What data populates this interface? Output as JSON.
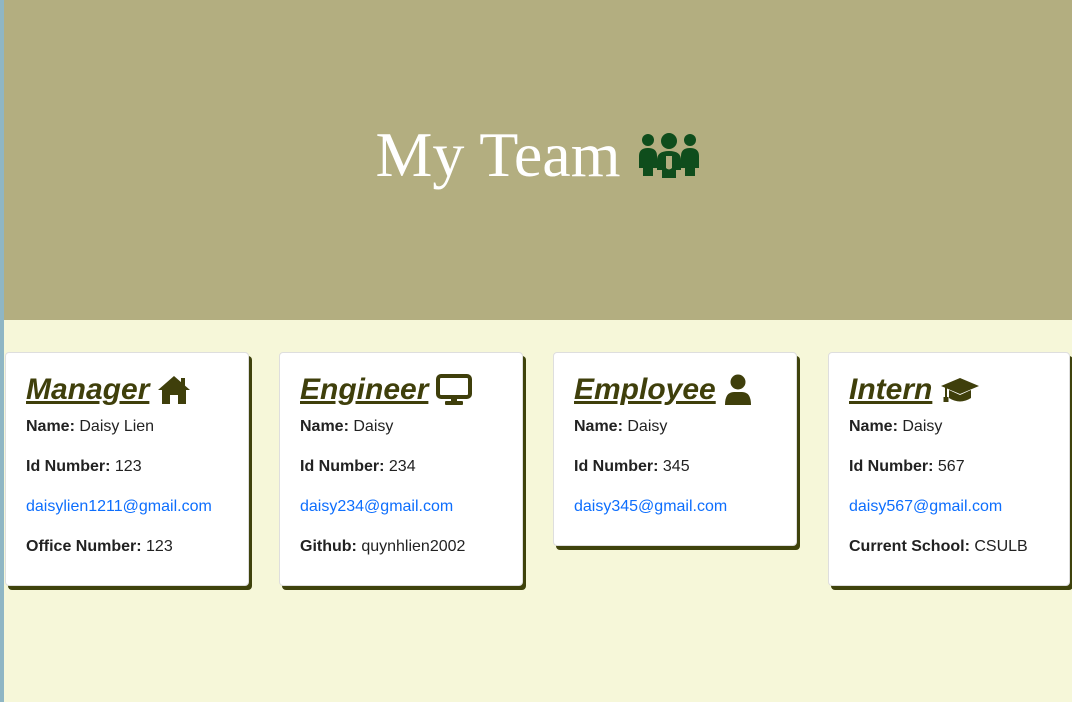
{
  "header": {
    "title": "My Team",
    "icon": "people-group-icon",
    "icon_color": "#0f4d1c",
    "background": "#b3ae80"
  },
  "cards": [
    {
      "role": "Manager",
      "icon": "house-icon",
      "name_label": "Name:",
      "name": "Daisy Lien",
      "id_label": "Id Number:",
      "id": "123",
      "email": "daisylien1211@gmail.com",
      "extra_label": "Office Number:",
      "extra_value": "123"
    },
    {
      "role": "Engineer",
      "icon": "desktop-icon",
      "name_label": "Name:",
      "name": "Daisy",
      "id_label": "Id Number:",
      "id": "234",
      "email": "daisy234@gmail.com",
      "extra_label": "Github:",
      "extra_value": "quynhlien2002"
    },
    {
      "role": "Employee",
      "icon": "user-icon",
      "name_label": "Name:",
      "name": "Daisy",
      "id_label": "Id Number:",
      "id": "345",
      "email": "daisy345@gmail.com"
    },
    {
      "role": "Intern",
      "icon": "graduation-cap-icon",
      "name_label": "Name:",
      "name": "Daisy",
      "id_label": "Id Number:",
      "id": "567",
      "email": "daisy567@gmail.com",
      "extra_label": "Current School:",
      "extra_value": "CSULB"
    }
  ],
  "colors": {
    "page_background": "#f6f7d9",
    "card_shadow": "#3f430c",
    "title_color": "#3f3f0b",
    "link_color": "#0d6efd"
  }
}
